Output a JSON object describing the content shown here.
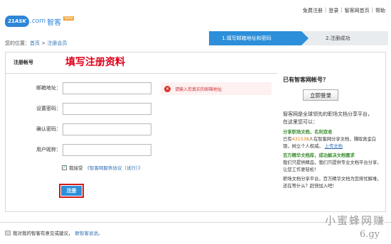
{
  "logo": {
    "mark": "21ASK",
    "com": ".com",
    "name": "智客",
    "badge": "beta"
  },
  "topnav": [
    "免费注册",
    "登录",
    "智客网首页",
    "帮助"
  ],
  "breadcrumb": {
    "prefix": "您的位置：",
    "home": "首页",
    "arrow1": ">",
    "current": "注册会员"
  },
  "steps": {
    "step1": "1.填写邮箱地址和密码",
    "step2": "2.注册成功"
  },
  "form": {
    "section_label": "注册帐号",
    "heading": "填写注册资料",
    "fields": [
      {
        "label": "邮箱地址：",
        "value": ""
      },
      {
        "label": "设置密码：",
        "value": ""
      },
      {
        "label": "确认密码：",
        "value": ""
      },
      {
        "label": "用户昵称：",
        "value": ""
      }
    ],
    "error": "请输入您真实的邮箱地址",
    "agree_text": "我接受",
    "agree_link": "《智客网服务协议（试行）》",
    "submit": "注册"
  },
  "sidebar": {
    "question": "已有智客网帐号？",
    "login": "立即登录",
    "intro": "智客网是全球领先的职场文档分享平台，在这里您可以：",
    "s1_title": "分享职场文档，名利双收",
    "s1_a": "已有",
    "s1_count": "431538",
    "s1_b": "人在智客网分享文档，赚取真金白银，树立个人权威。",
    "s1_link": "上传文档",
    "s2_title": "百万精华文档库，成功解决文档需求",
    "s2_body": "我们只提供精品，我们只提供专业文档平台分享，让您工作更轻松！",
    "s3_body": "职场文档分享平台，百万精华文档为您排忧解难，还在等什么？赶快加入吧！"
  },
  "footer": {
    "text": "我对我的智客有意见或建议，",
    "link": "联智客说说。"
  },
  "watermark": {
    "line1": "小蜜蜂网赚",
    "line2": "6.gy"
  },
  "colors": {
    "accent": "#2d8fd9",
    "title_red": "#e0001a",
    "error_red": "#d9362f"
  }
}
